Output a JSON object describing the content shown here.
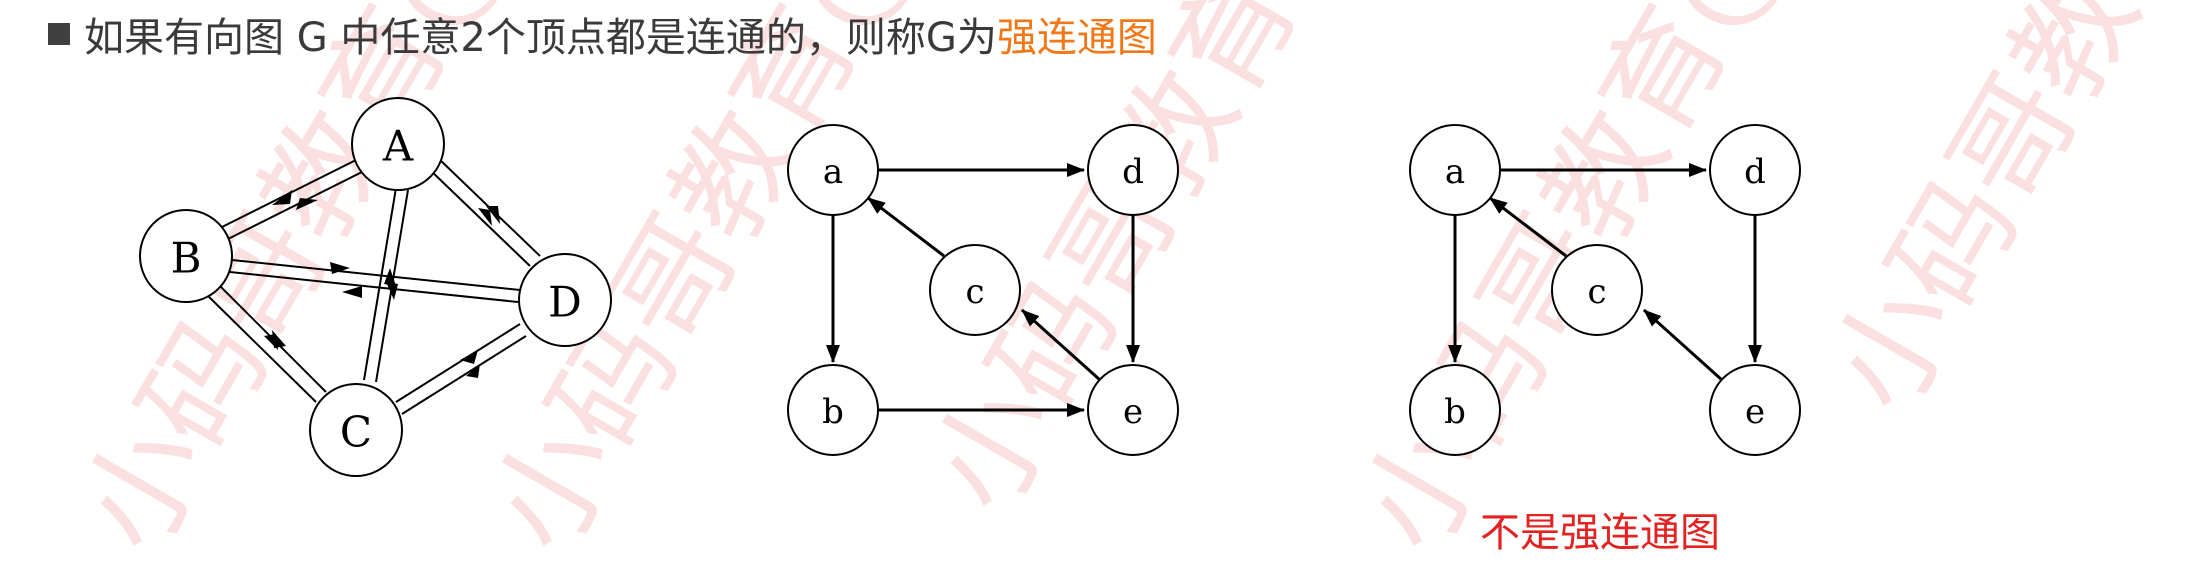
{
  "heading": {
    "text": "如果有向图 G 中任意2个顶点都是连通的，则称G为",
    "highlight": "强连通图"
  },
  "watermark": {
    "text": "小码哥教育@MJ"
  },
  "graph1": {
    "nodes": [
      "A",
      "B",
      "C",
      "D"
    ]
  },
  "graph2": {
    "nodes": [
      "a",
      "d",
      "c",
      "b",
      "e"
    ]
  },
  "graph3": {
    "nodes": [
      "a",
      "d",
      "c",
      "b",
      "e"
    ],
    "caption": "不是强连通图"
  },
  "colors": {
    "heading_text": "#3a3a3a",
    "highlight": "#f07818",
    "caption": "#e32222",
    "watermark": "#f2b3b3"
  }
}
